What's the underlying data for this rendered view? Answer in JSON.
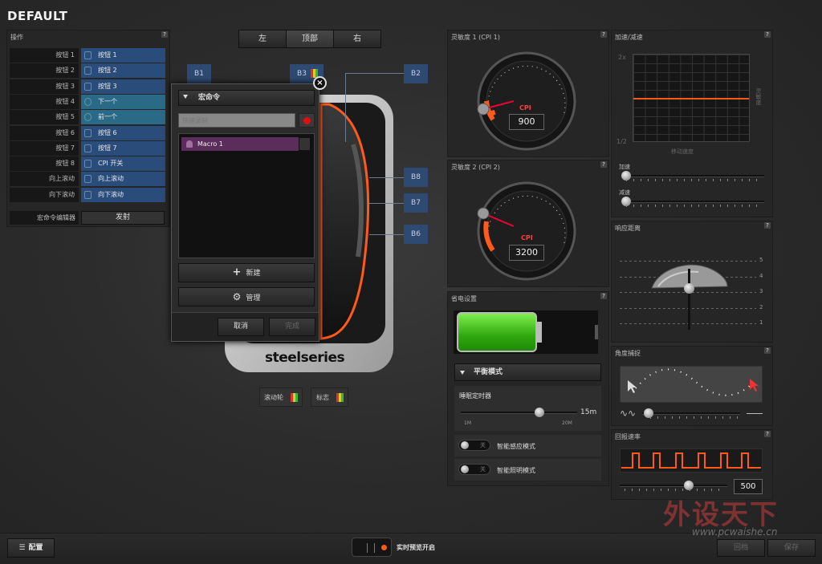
{
  "app_title": "DEFAULT",
  "actions_panel": {
    "title": "操作",
    "rows": [
      {
        "key": "按钮 1",
        "action": "按钮 1"
      },
      {
        "key": "按钮 2",
        "action": "按钮 2"
      },
      {
        "key": "按钮 3",
        "action": "按钮 3"
      },
      {
        "key": "按钮 4",
        "action": "下一个"
      },
      {
        "key": "按钮 5",
        "action": "前一个"
      },
      {
        "key": "按钮 6",
        "action": "按钮 6"
      },
      {
        "key": "按钮 7",
        "action": "按钮 7"
      },
      {
        "key": "按钮 8",
        "action": "CPI 开关"
      },
      {
        "key": "向上滚动",
        "action": "向上滚动"
      },
      {
        "key": "向下滚动",
        "action": "向下滚动"
      }
    ],
    "macro_editor_label": "宏命令编辑器",
    "launch_label": "发射"
  },
  "view_tabs": [
    "左",
    "顶部",
    "右"
  ],
  "mouse_tags": {
    "b1": "B1",
    "b2": "B2",
    "b3": "B3",
    "b6": "B6",
    "b7": "B7",
    "b8": "B8"
  },
  "brand": "steelseries",
  "bottom_tags": {
    "wheel": "滚动轮",
    "logo": "标志"
  },
  "macro_popup": {
    "header": "宏命令",
    "search_placeholder": "快速录制",
    "items": [
      "Macro 1"
    ],
    "new_label": "新建",
    "manage_label": "管理",
    "cancel_label": "取消",
    "done_label": "完成"
  },
  "cpi1": {
    "title": "灵敏度 1 (CPI 1)",
    "unit": "CPI",
    "value": "900"
  },
  "cpi2": {
    "title": "灵敏度 2 (CPI 2)",
    "unit": "CPI",
    "value": "3200"
  },
  "power": {
    "title": "省电设置",
    "mode": "平衡模式",
    "timer_label": "睡眠定时器",
    "timer_value": "15m",
    "range_min": "1M",
    "range_max": "20M",
    "toggle1_label": "智能感应模式",
    "toggle2_label": "智能照明模式",
    "toggle_state": "关"
  },
  "accel": {
    "title": "加速/减速",
    "y_top": "2x",
    "y_bottom": "1/2",
    "x_label": "移动速度",
    "y_side_label": "灵敏度",
    "accel_label": "加速",
    "decel_label": "减速"
  },
  "lift": {
    "title": "响应距离",
    "levels": [
      "5",
      "4",
      "3",
      "2",
      "1"
    ]
  },
  "angle": {
    "title": "角度捕捉"
  },
  "polling": {
    "title": "回报速率",
    "value": "500"
  },
  "footer": {
    "config_label": "配置",
    "live_preview_label": "实时预览开启",
    "revert_label": "回档",
    "save_label": "保存",
    "watermark_title": "外设天下",
    "watermark_url": "www.pcwaishe.cn"
  },
  "colors": {
    "accent": "#ff5a1a",
    "blue_button": "#2a4c7a",
    "teal_button": "#2a6a86",
    "macro_item": "#5a2d5a",
    "battery": "#3fcf1a"
  }
}
